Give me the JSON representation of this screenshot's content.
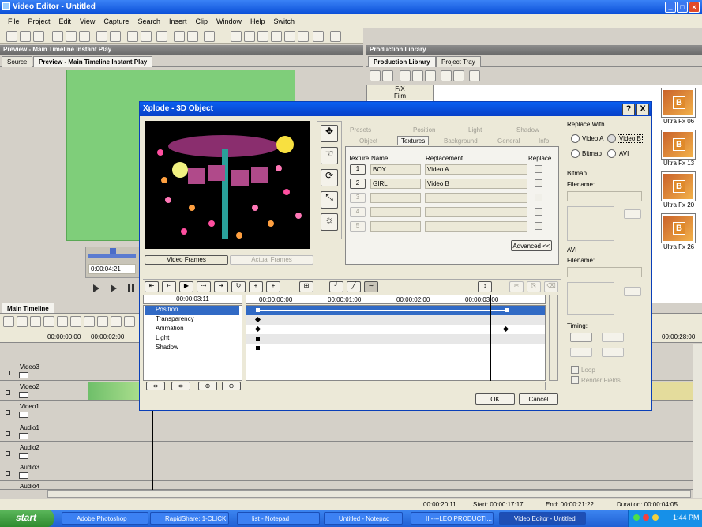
{
  "app": {
    "title": "Video Editor - Untitled"
  },
  "menu": [
    "File",
    "Project",
    "Edit",
    "View",
    "Capture",
    "Search",
    "Insert",
    "Clip",
    "Window",
    "Help",
    "Switch"
  ],
  "preview": {
    "header": "Preview - Main Timeline Instant Play",
    "tabs": [
      "Source",
      "Preview - Main Timeline Instant Play"
    ],
    "timecode": "0:00:04:21"
  },
  "library": {
    "header": "Production Library",
    "tabs": [
      "Production Library",
      "Project Tray"
    ],
    "tree": [
      "F/X",
      "Film"
    ],
    "items": [
      "Ultra Fx 06",
      "Ultra Fx 13",
      "Ultra Fx 20",
      "Ultra Fx 26"
    ]
  },
  "timeline": {
    "header": "Main Timeline",
    "ruler": [
      "00:00:00:00",
      "00:00:02:00",
      "00:00:28:00"
    ],
    "tracks": [
      "Video3",
      "Video2",
      "Video1",
      "Audio1",
      "Audio2",
      "Audio3",
      "Audio4"
    ]
  },
  "status": {
    "left": "00:00:20:11",
    "start": "Start: 00:00:17:17",
    "end": "End: 00:00:21:22",
    "duration": "Duration: 00:00:04:05"
  },
  "dialog": {
    "title": "Xplode - 3D Object",
    "help": "?",
    "close": "X",
    "tabs_row1": [
      "Presets",
      "Position",
      "Light",
      "Shadow"
    ],
    "tabs_row2": [
      "Object",
      "Textures",
      "Background",
      "General",
      "Info"
    ],
    "frame_tabs": [
      "Video Frames",
      "Actual Frames"
    ],
    "texture_cols": {
      "texture": "Texture",
      "name": "Name",
      "replacement": "Replacement",
      "replace": "Replace"
    },
    "textures": [
      {
        "num": "1",
        "name": "BOY",
        "replacement": "Video A"
      },
      {
        "num": "2",
        "name": "GIRL",
        "replacement": "Video B"
      },
      {
        "num": "3",
        "name": "",
        "replacement": ""
      },
      {
        "num": "4",
        "name": "",
        "replacement": ""
      },
      {
        "num": "5",
        "name": "",
        "replacement": ""
      }
    ],
    "advanced": "Advanced <<",
    "replace_with": {
      "label": "Replace With",
      "options": [
        "Video A",
        "Video B",
        "Bitmap",
        "AVI"
      ],
      "selected": "Video B"
    },
    "bitmap": {
      "label": "Bitmap",
      "filename": "Filename:"
    },
    "avi": {
      "label": "AVI",
      "filename": "Filename:"
    },
    "timing": {
      "label": "Timing:",
      "loop": "Loop",
      "render_fields": "Render Fields"
    },
    "kf_time": "00:00:03:11",
    "kf_ruler": [
      "00:00:00:00",
      "00:00:01:00",
      "00:00:02:00",
      "00:00:03:00"
    ],
    "kf_rows": [
      "Position",
      "Transparency",
      "Animation",
      "Light",
      "Shadow"
    ],
    "ok": "OK",
    "cancel": "Cancel"
  },
  "taskbar": {
    "start": "start",
    "items": [
      "Adobe Photoshop",
      "RapidShare: 1-CLICK ...",
      "list - Notepad",
      "Untitled - Notepad",
      "III----LEO PRODUCTI...",
      "Video Editor - Untitled"
    ],
    "clock": "1:44 PM"
  }
}
